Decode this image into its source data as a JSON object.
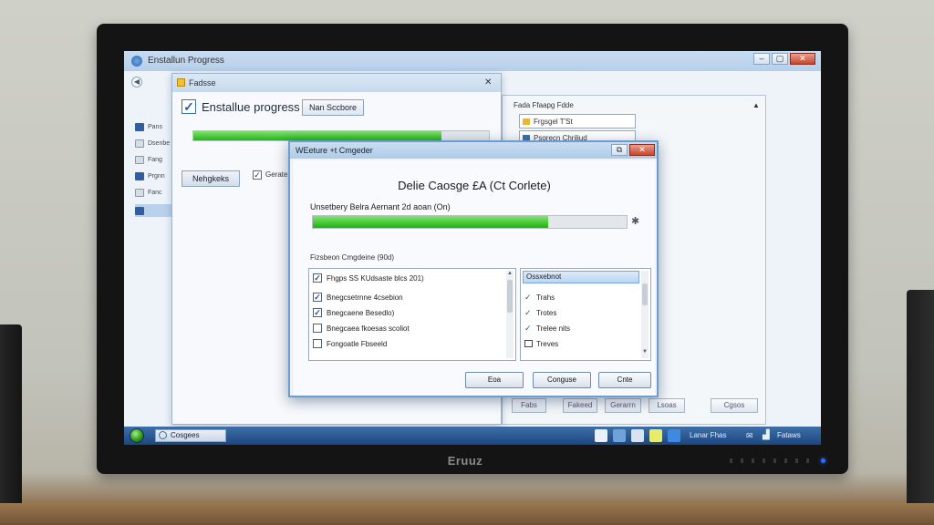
{
  "window": {
    "title": "Enstallun Progress"
  },
  "installer": {
    "title": "Fadsse",
    "heading": "Enstallue progress",
    "top_button": "Nan Sccbore",
    "progress_fraction": 0.84,
    "nav_button": "Nehgkeks",
    "option_label": "Gerate"
  },
  "right_panel": {
    "title": "Fada Ffaapg Fdde",
    "items": [
      "Frgsgel T'St",
      "Psgrecn Chriliud"
    ],
    "buttons": [
      "Fabs",
      "Fakeed",
      "Gerarrn",
      "Lsoas",
      "Cgsos"
    ]
  },
  "dialog": {
    "title": "WEeture +t Cmgeder",
    "heading": "Delie Caosge £A (Ct Corlete)",
    "progress_label": "Unsetbery Belra Aernant 2d aoan (On)",
    "progress_fraction": 0.75,
    "spinner": "✱",
    "section_label": "Fizsbeon Cmgdeine (90d)",
    "left_list": [
      {
        "label": "Fhgps SS KUdsaste blcs 201)",
        "checked": true
      },
      {
        "label": "Bnegcsetrnne 4csebion",
        "checked": true
      },
      {
        "label": "Bnegcaene Besedlo)",
        "checked": true
      },
      {
        "label": "Bnegcaea fkoesas scoliot",
        "checked": false
      },
      {
        "label": "Fongoatle Fbseeld",
        "checked": false
      }
    ],
    "right_list_header": "Ossxebnot",
    "right_list": [
      {
        "label": "Trahs",
        "mark": "check"
      },
      {
        "label": "Trotes",
        "mark": "check"
      },
      {
        "label": "Trelee nits",
        "mark": "check"
      },
      {
        "label": "Treves",
        "mark": "box"
      }
    ],
    "buttons": {
      "back": "Eoa",
      "configure": "Conguse",
      "close": "Cnte"
    }
  },
  "sidebar": {
    "items": [
      "Pans",
      "Dsenbe",
      "Fang",
      "Prgnn",
      "Fanc"
    ]
  },
  "taskbar": {
    "search": "Cosgees",
    "tray_a": "Lanar Fhas",
    "tray_b": "Fataws"
  },
  "monitor": {
    "brand": "Eruuz"
  },
  "colors": {
    "progress_green": "#22b514",
    "accent_blue": "#2d5ea0",
    "taskbar": "#1c4680"
  }
}
